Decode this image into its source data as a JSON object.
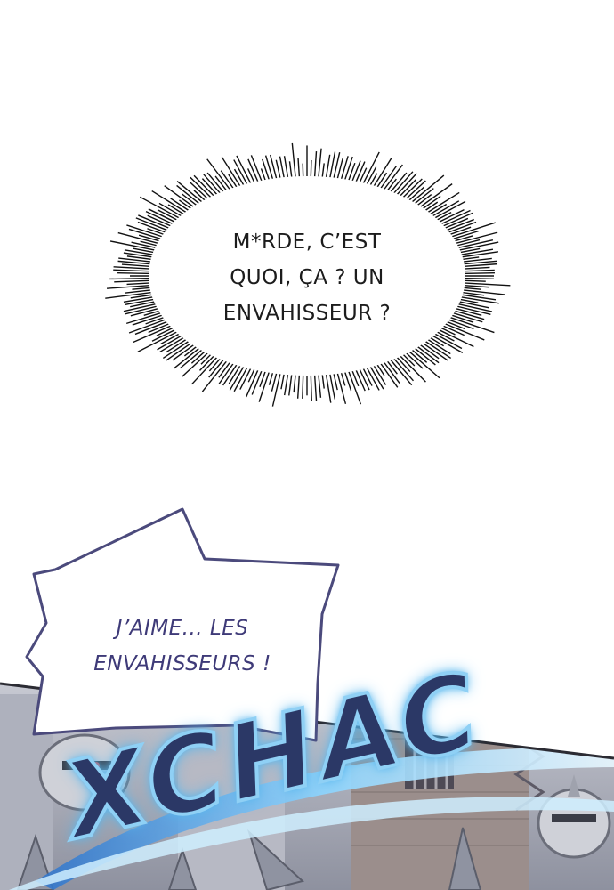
{
  "thought_bubble": {
    "lines": [
      "M*RDE, C’EST",
      "QUOI, ÇA ? UN",
      "ENVAHISSEUR ?"
    ]
  },
  "shout_bubble": {
    "lines": [
      "J’AIME... LES",
      "ENVAHISSEURS !"
    ]
  },
  "sound_effect": {
    "text": "XCHAC"
  },
  "colors": {
    "background": "#ffffff",
    "thought_text": "#1c1c1c",
    "shout_text": "#3e3a78",
    "shout_outline": "#4b4a7c",
    "sfx_fill": "#2b3866",
    "sfx_glow": "#8fd0f5",
    "slash_blue": "#5aa9e6"
  }
}
